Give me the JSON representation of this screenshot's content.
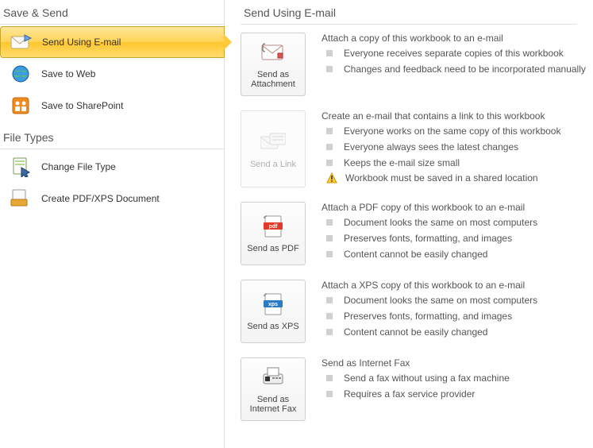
{
  "left": {
    "header": "Save & Send",
    "nav": [
      {
        "label": "Send Using E-mail",
        "icon": "envelope-send-icon",
        "selected": true
      },
      {
        "label": "Save to Web",
        "icon": "globe-icon",
        "selected": false
      },
      {
        "label": "Save to SharePoint",
        "icon": "sharepoint-icon",
        "selected": false
      }
    ],
    "fileTypesHeader": "File Types",
    "fileTypes": [
      {
        "label": "Change File Type",
        "icon": "change-file-type-icon"
      },
      {
        "label": "Create PDF/XPS Document",
        "icon": "pdf-xps-icon"
      }
    ]
  },
  "right": {
    "header": "Send Using E-mail",
    "options": [
      {
        "tile": "Send as Attachment",
        "icon": "attachment-icon",
        "disabled": false,
        "title": "Attach a copy of this workbook to an e-mail",
        "bullets": [
          "Everyone receives separate copies of this workbook",
          "Changes and feedback need to be incorporated manually"
        ]
      },
      {
        "tile": "Send a Link",
        "icon": "link-envelope-icon",
        "disabled": true,
        "title": "Create an e-mail that contains a link to this workbook",
        "bullets": [
          "Everyone works on the same copy of this workbook",
          "Everyone always sees the latest changes",
          "Keeps the e-mail size small"
        ],
        "warning": "Workbook must be saved in a shared location"
      },
      {
        "tile": "Send as PDF",
        "icon": "pdf-icon",
        "disabled": false,
        "title": "Attach a PDF copy of this workbook to an e-mail",
        "bullets": [
          "Document looks the same on most computers",
          "Preserves fonts, formatting, and images",
          "Content cannot be easily changed"
        ]
      },
      {
        "tile": "Send as XPS",
        "icon": "xps-icon",
        "disabled": false,
        "title": "Attach a XPS copy of this workbook to an e-mail",
        "bullets": [
          "Document looks the same on most computers",
          "Preserves fonts, formatting, and images",
          "Content cannot be easily changed"
        ]
      },
      {
        "tile": "Send as Internet Fax",
        "icon": "fax-icon",
        "disabled": false,
        "title": "Send as Internet Fax",
        "bullets": [
          "Send a fax without using a fax machine",
          "Requires a fax service provider"
        ]
      }
    ]
  }
}
